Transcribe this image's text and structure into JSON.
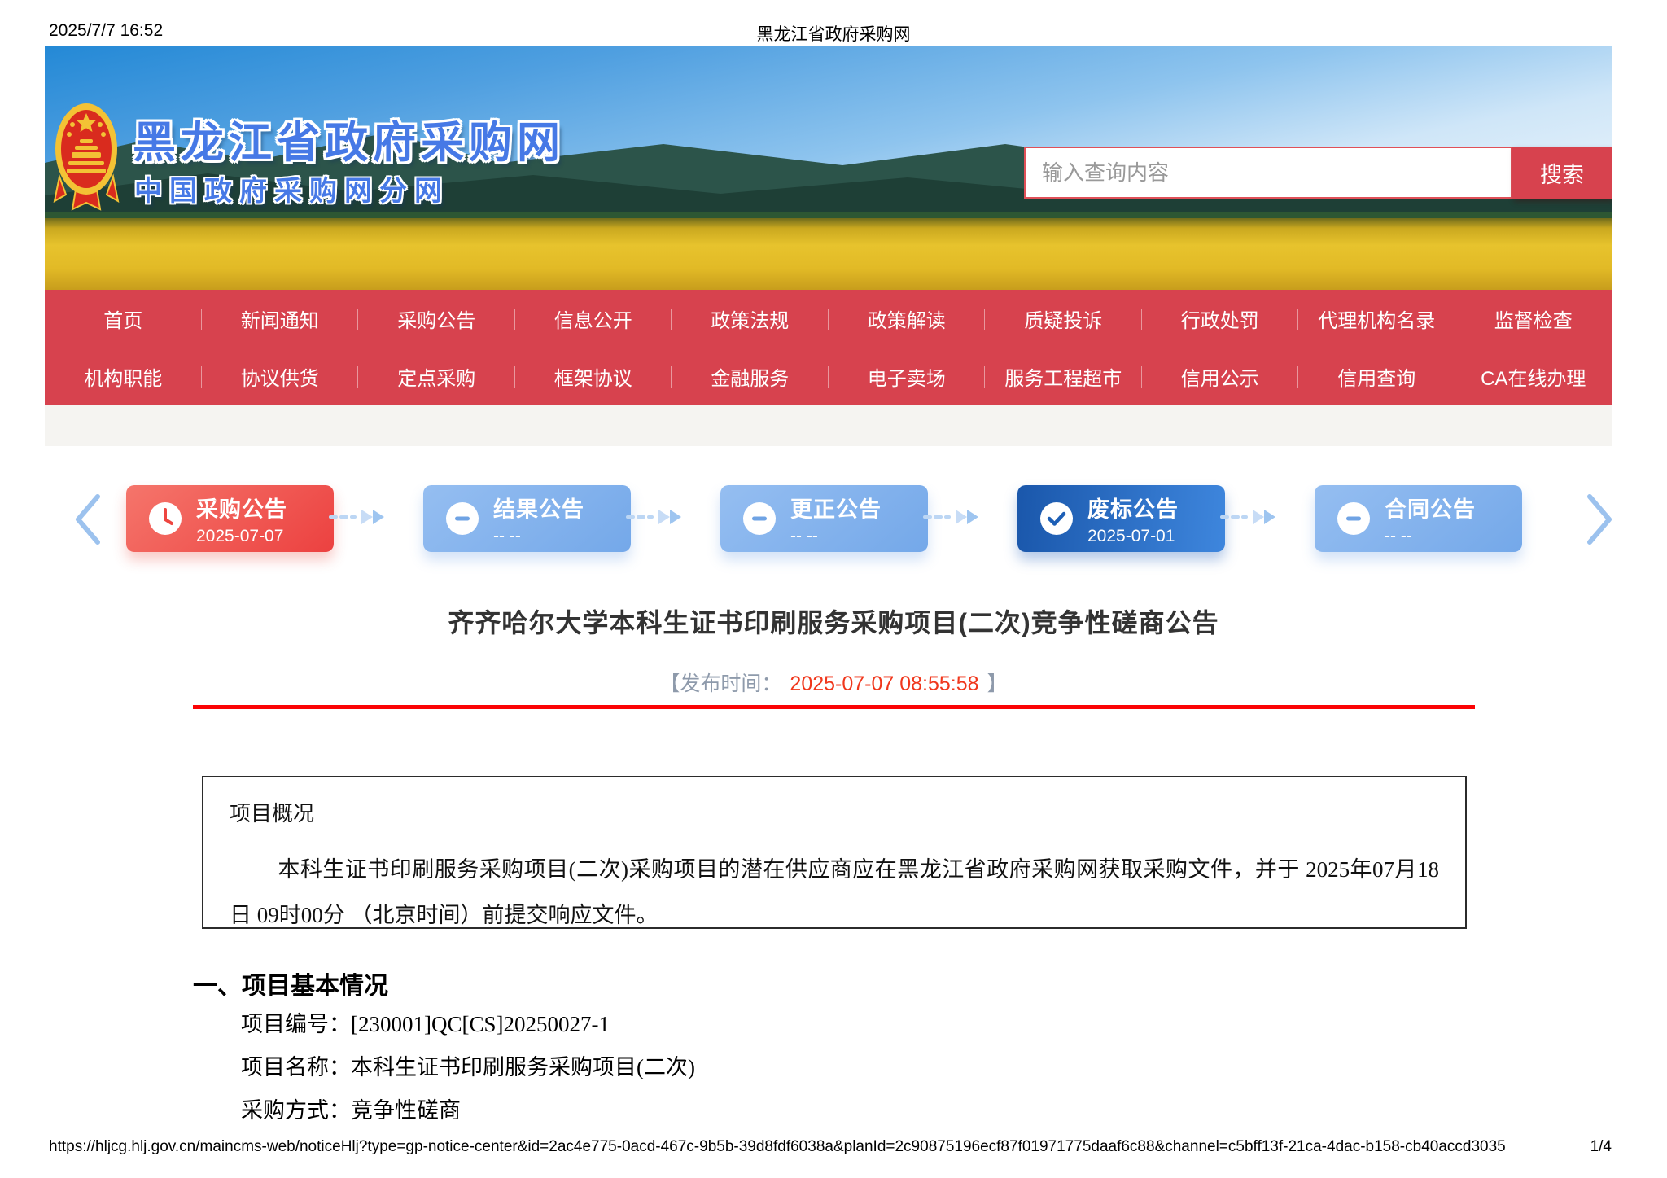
{
  "print_header": {
    "datetime": "2025/7/7 16:52",
    "title": "黑龙江省政府采购网"
  },
  "banner": {
    "site_title": "黑龙江省政府采购网",
    "site_subtitle": "中国政府采购网分网",
    "emblem_icon": "china-national-emblem",
    "search": {
      "placeholder": "输入查询内容",
      "button_label": "搜索"
    }
  },
  "nav": {
    "row1": [
      "首页",
      "新闻通知",
      "采购公告",
      "信息公开",
      "政策法规",
      "政策解读",
      "质疑投诉",
      "行政处罚",
      "代理机构名录",
      "监督检查"
    ],
    "row2": [
      "机构职能",
      "协议供货",
      "定点采购",
      "框架协议",
      "金融服务",
      "电子卖场",
      "服务工程超市",
      "信用公示",
      "信用查询",
      "CA在线办理"
    ]
  },
  "timeline": {
    "steps": [
      {
        "label": "采购公告",
        "date": "2025-07-07",
        "status": "current",
        "icon": "clock-icon"
      },
      {
        "label": "结果公告",
        "date": "-- --",
        "status": "pending",
        "icon": "minus-icon"
      },
      {
        "label": "更正公告",
        "date": "-- --",
        "status": "pending",
        "icon": "minus-icon"
      },
      {
        "label": "废标公告",
        "date": "2025-07-01",
        "status": "done",
        "icon": "check-icon"
      },
      {
        "label": "合同公告",
        "date": "-- --",
        "status": "pending",
        "icon": "minus-icon"
      }
    ]
  },
  "article": {
    "title": "齐齐哈尔大学本科生证书印刷服务采购项目(二次)竞争性磋商公告",
    "publish_prefix": "【发布时间：",
    "publish_time": "2025-07-07 08:55:58",
    "publish_suffix": "】",
    "overview_title": "项目概况",
    "overview_text": "本科生证书印刷服务采购项目(二次)采购项目的潜在供应商应在黑龙江省政府采购网获取采购文件，并于 2025年07月18日 09时00分 （北京时间）前提交响应文件。",
    "section1_title": "一、项目基本情况",
    "fields": [
      {
        "label": "项目编号：",
        "value": "[230001]QC[CS]20250027-1"
      },
      {
        "label": "项目名称：",
        "value": "本科生证书印刷服务采购项目(二次)"
      },
      {
        "label": "采购方式：",
        "value": "竞争性磋商"
      }
    ]
  },
  "print_footer": {
    "url": "https://hljcg.hlj.gov.cn/maincms-web/noticeHlj?type=gp-notice-center&id=2ac4e775-0acd-467c-9b5b-39d8fdf6038a&planId=2c90875196ecf87f01971775daaf6c88&channel=c5bff13f-21ca-4dac-b158-cb40accd3035",
    "page": "1/4"
  },
  "colors": {
    "nav_red": "#d7424e",
    "card_red": "#ec4140",
    "card_blue": "#76a9e9",
    "card_dark_blue": "#1a57ab",
    "divider_red": "#fb0304",
    "publish_time_red": "#f0371c",
    "banner_title_blue": "#4679e6"
  }
}
